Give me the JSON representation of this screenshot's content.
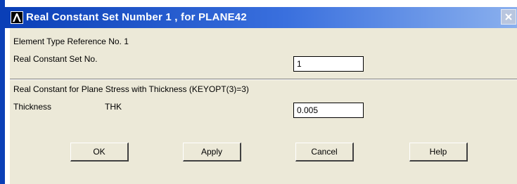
{
  "window": {
    "title": "Real Constant Set Number 1 , for PLANE42",
    "app_icon": "ansys-lambda-icon",
    "close_icon": "close-icon"
  },
  "form": {
    "element_type_ref_label": "Element Type Reference No. 1",
    "real_const_set_label": "Real Constant Set No.",
    "real_const_set_value": "1",
    "section_heading": "Real Constant for Plane Stress with Thickness (KEYOPT(3)=3)",
    "thickness_label": "Thickness",
    "thickness_symbol": "THK",
    "thickness_value": "0.005"
  },
  "buttons": {
    "ok": "OK",
    "apply": "Apply",
    "cancel": "Cancel",
    "help": "Help"
  },
  "colors": {
    "titlebar": "#0a3fb7",
    "dialog_bg": "#ece9d8"
  }
}
